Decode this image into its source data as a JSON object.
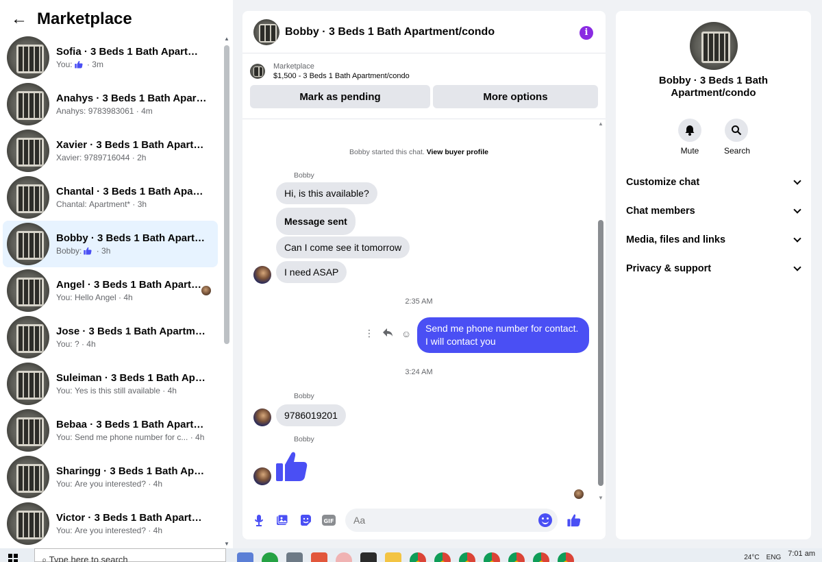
{
  "sidebar": {
    "title": "Marketplace",
    "items": [
      {
        "name": "Sofia · 3 Beds 1 Bath Apartment/...",
        "prefix": "You:",
        "like": true,
        "snippet": "",
        "time": "3m"
      },
      {
        "name": "Anahys · 3 Beds 1 Bath Apartme...",
        "prefix": "Anahys:",
        "like": false,
        "snippet": "9783983061",
        "time": "4m"
      },
      {
        "name": "Xavier · 3 Beds 1 Bath Apartmen...",
        "prefix": "Xavier:",
        "like": false,
        "snippet": "9789716044",
        "time": "2h"
      },
      {
        "name": "Chantal · 3 Beds 1 Bath Apartme...",
        "prefix": "Chantal:",
        "like": false,
        "snippet": "Apartment*",
        "time": "3h"
      },
      {
        "name": "Bobby · 3 Beds 1 Bath Apartmen...",
        "prefix": "Bobby:",
        "like": true,
        "snippet": "",
        "time": "3h",
        "active": true
      },
      {
        "name": "Angel · 3 Beds 1 Bath Apartm...",
        "prefix": "You:",
        "like": false,
        "snippet": "Hello Angel",
        "time": "4h",
        "seen": true
      },
      {
        "name": "Jose · 3 Beds 1 Bath Apartment/...",
        "prefix": "You:",
        "like": false,
        "snippet": "?",
        "time": "4h"
      },
      {
        "name": "Suleiman · 3 Beds 1 Bath Apartm...",
        "prefix": "You:",
        "like": false,
        "snippet": "Yes is this still available",
        "time": "4h"
      },
      {
        "name": "Bebaa · 3 Beds 1 Bath Apartmen...",
        "prefix": "You:",
        "like": false,
        "snippet": "Send me phone number for c...",
        "time": "4h"
      },
      {
        "name": "Sharingg · 3 Beds 1 Bath Apartm...",
        "prefix": "You:",
        "like": false,
        "snippet": "Are you interested?",
        "time": "4h"
      },
      {
        "name": "Victor · 3 Beds 1 Bath Apartment...",
        "prefix": "You:",
        "like": false,
        "snippet": "Are you interested?",
        "time": "4h"
      }
    ]
  },
  "chat": {
    "title": "Bobby · 3 Beds 1 Bath Apartment/condo",
    "listing_label": "Marketplace",
    "listing_price": "$1,500 - 3 Beds 1 Bath Apartment/condo",
    "mark_pending": "Mark as pending",
    "more_options": "More options",
    "system_text": "Bobby started this chat.",
    "system_link": "View buyer profile",
    "sender": "Bobby",
    "msg1": "Hi, is this available?",
    "msg2": "Message sent",
    "msg3": "Can I come see it tomorrow",
    "msg4": "I need ASAP",
    "time1": "2:35 AM",
    "out_msg": "Send me phone number for contact. I will contact you",
    "time2": "3:24 AM",
    "msg5": "9786019201",
    "composer_placeholder": "Aa"
  },
  "rpanel": {
    "name": "Bobby · 3 Beds 1 Bath Apartment/condo",
    "mute": "Mute",
    "search": "Search",
    "sections": [
      "Customize chat",
      "Chat members",
      "Media, files and links",
      "Privacy & support"
    ]
  },
  "taskbar": {
    "search_placeholder": "Type here to search",
    "weather": "24°C",
    "lang": "ENG",
    "clock": "7:01 am"
  },
  "colors": {
    "accent": "#4a4ff4",
    "active_row": "#e7f3ff",
    "bubble_in": "#e4e6eb"
  }
}
